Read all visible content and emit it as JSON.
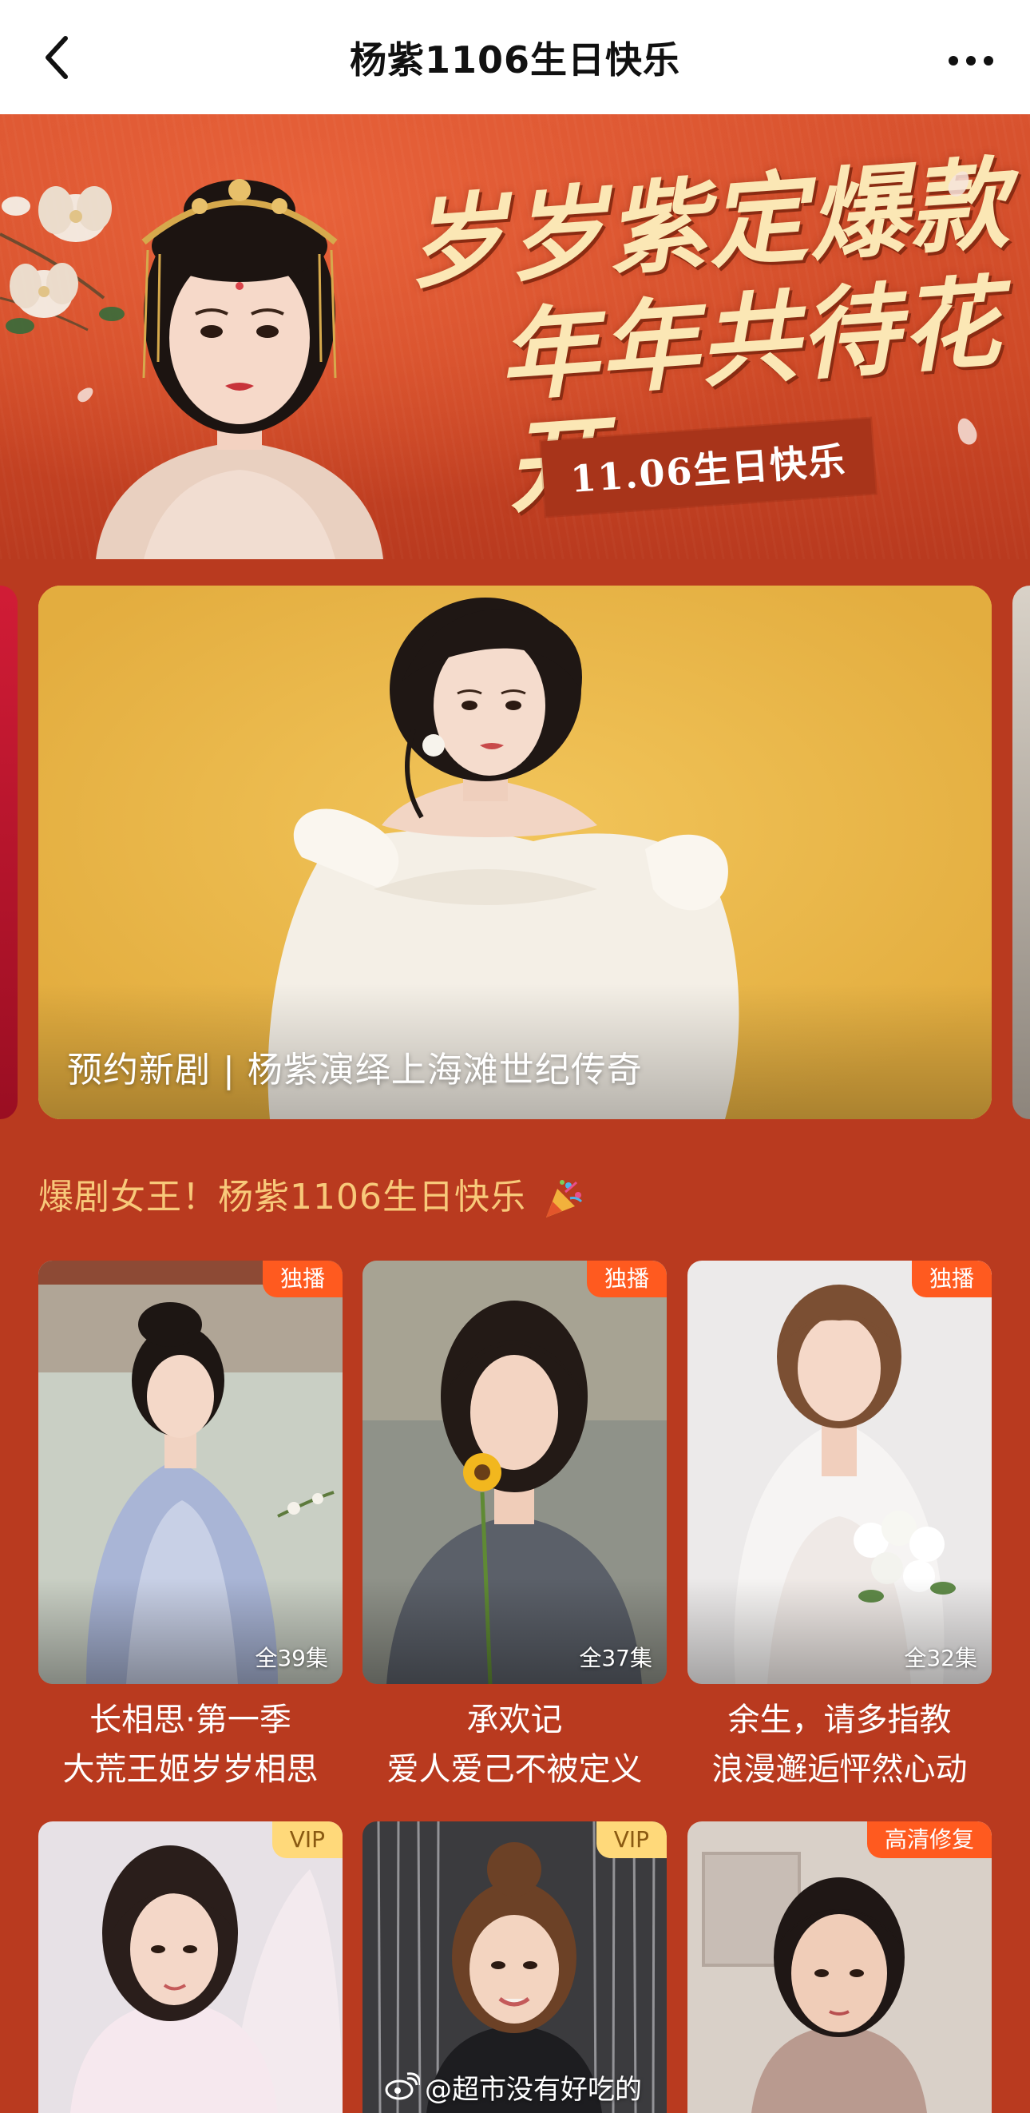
{
  "nav": {
    "title": "杨紫1106生日快乐",
    "back_icon": "chevron-left-icon",
    "more_icon": "more-horizontal-icon"
  },
  "banner": {
    "slogan_line1": "岁岁紫定爆款",
    "slogan_line2": "年年共待花开",
    "date_text": "11.06生日快乐"
  },
  "carousel": {
    "caption": "预约新剧 | 杨紫演绎上海滩世纪传奇"
  },
  "section": {
    "title": "爆剧女王！杨紫1106生日快乐",
    "title_icon": "party-popper-icon"
  },
  "dramas": [
    {
      "badge": "独播",
      "episodes": "全39集",
      "title": "长相思·第一季",
      "subtitle": "大荒王姬岁岁相思"
    },
    {
      "badge": "独播",
      "episodes": "全37集",
      "title": "承欢记",
      "subtitle": "爱人爱己不被定义"
    },
    {
      "badge": "独播",
      "episodes": "全32集",
      "title": "余生，请多指教",
      "subtitle": "浪漫邂逅怦然心动"
    },
    {
      "badge": "VIP"
    },
    {
      "badge": "VIP"
    },
    {
      "badge": "高清修复"
    }
  ],
  "watermark": {
    "icon": "weibo-icon",
    "text": "@超市没有好吃的"
  },
  "colors": {
    "page_background": "#b93a1f",
    "section_title": "#f8c97a",
    "exclusive_badge": "#ff5a1f",
    "vip_badge": "#ffd97a"
  }
}
